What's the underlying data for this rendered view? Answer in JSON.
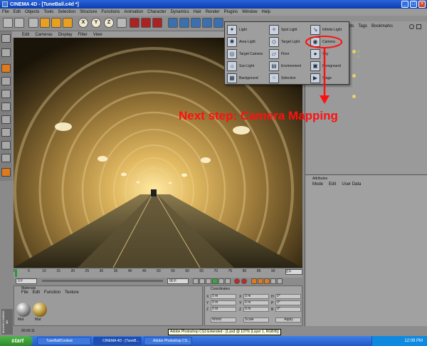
{
  "window": {
    "title": "CINEMA 4D - [TuneBall.c4d *]"
  },
  "menubar": [
    "File",
    "Edit",
    "Objects",
    "Tools",
    "Selection",
    "Structure",
    "Functions",
    "Animation",
    "Character",
    "Dynamics",
    "Hair",
    "Render",
    "Plugins",
    "Window",
    "Help"
  ],
  "viewport_menu": [
    "Edit",
    "Cameras",
    "Display",
    "Filter",
    "View"
  ],
  "toolbar_letters": [
    "X",
    "Y",
    "Z"
  ],
  "popup_items": [
    {
      "label": "Light",
      "icon": "light-icon"
    },
    {
      "label": "Spot Light",
      "icon": "spot-light-icon"
    },
    {
      "label": "Infinite Light",
      "icon": "infinite-light-icon"
    },
    {
      "label": "Area Light",
      "icon": "area-light-icon"
    },
    {
      "label": "Target Light",
      "icon": "target-light-icon"
    },
    {
      "label": "Camera",
      "icon": "camera-icon"
    },
    {
      "label": "Target Camera",
      "icon": "target-camera-icon"
    },
    {
      "label": "Floor",
      "icon": "floor-icon"
    },
    {
      "label": "Sky",
      "icon": "sky-icon"
    },
    {
      "label": "Sun Light",
      "icon": "sun-light-icon"
    },
    {
      "label": "Environment",
      "icon": "environment-icon"
    },
    {
      "label": "Foreground",
      "icon": "foreground-icon"
    },
    {
      "label": "Background",
      "icon": "background-icon"
    },
    {
      "label": "Selection",
      "icon": "selection-icon"
    },
    {
      "label": "Stage",
      "icon": "stage-icon"
    }
  ],
  "annotation": {
    "text": "Next step: Camera Mapping",
    "color": "#ff1010"
  },
  "object_tabs": [
    "Objects",
    "Tags",
    "Bookmarks"
  ],
  "attributes": {
    "title": "Attributes",
    "menu": [
      "Mode",
      "Edit",
      "User Data"
    ]
  },
  "timeline": {
    "ticks": [
      "0",
      "5",
      "10",
      "15",
      "20",
      "25",
      "30",
      "35",
      "40",
      "45",
      "50",
      "55",
      "60",
      "65",
      "70",
      "75",
      "80",
      "85",
      "90"
    ],
    "end_label": "0 F"
  },
  "transport": {
    "start": "0 F",
    "end": "90 F"
  },
  "materials": {
    "title": "Materials",
    "menu": [
      "File",
      "Edit",
      "Function",
      "Texture"
    ],
    "items": [
      "Mat",
      "Mat"
    ]
  },
  "coordinates": {
    "title": "Coordinates",
    "axes": [
      "X",
      "Y",
      "Z"
    ],
    "rot_labels": [
      "H",
      "P",
      "B"
    ],
    "fields": [
      "0 m",
      "0 m",
      "0 m",
      "0 m",
      "0 m",
      "0 m",
      "0°",
      "0°",
      "0°"
    ],
    "mode": "World",
    "scale": "Scale",
    "apply": "Apply"
  },
  "status": {
    "time": "00:00:11",
    "tooltip": "Adobe Photoshop CS3 Extended - [1.psd @ 107% (Layer 1, RGB/8)]"
  },
  "taskbar": {
    "start": "start",
    "tasks": [
      "TuneBallContest",
      "CINEMA 4D - [TuneB...",
      "Adobe Photoshop CS..."
    ],
    "clock": "12:09 PM"
  },
  "brand": {
    "logo": "MAXON CINEMA 4D"
  }
}
